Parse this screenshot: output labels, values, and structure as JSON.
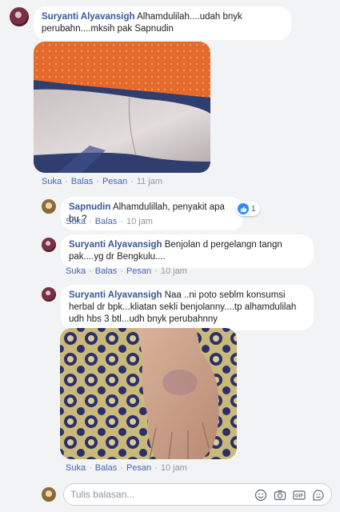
{
  "comments": [
    {
      "name": "Suryanti Alyavansigh",
      "text": "Alhamdulilah....udah bnyk perubahn....mksih pak Sapnudin",
      "actions": {
        "like": "Suka",
        "reply": "Balas",
        "message": "Pesan",
        "time": "11 jam"
      }
    },
    {
      "name": "Sapnudin",
      "text": "Alhamdulillah, penyakit apa bu ?",
      "reaction_count": "1",
      "actions": {
        "like": "Suka",
        "reply": "Balas",
        "time": "10 jam"
      }
    },
    {
      "name": "Suryanti Alyavansigh",
      "text": "Benjolan d pergelangn tangn pak....yg dr Bengkulu....",
      "actions": {
        "like": "Suka",
        "reply": "Balas",
        "message": "Pesan",
        "time": "10 jam"
      }
    },
    {
      "name": "Suryanti Alyavansigh",
      "text": "Naa ..ni poto seblm konsumsi herbal dr bpk...kliatan sekli benjolanny....tp alhamdulilah udh hbs 3 btl...udh bnyk perubahnny",
      "actions": {
        "like": "Suka",
        "reply": "Balas",
        "message": "Pesan",
        "time": "10 jam"
      }
    }
  ],
  "reply_box": {
    "placeholder": "Tulis balasan..."
  },
  "icons": [
    "emoji-icon",
    "camera-icon",
    "gif-icon",
    "sticker-icon",
    "like-reaction-icon"
  ],
  "colors": {
    "name_link": "#385898",
    "action_link": "#4267b2",
    "muted": "#90949c",
    "like_blue": "#2d88ff"
  }
}
